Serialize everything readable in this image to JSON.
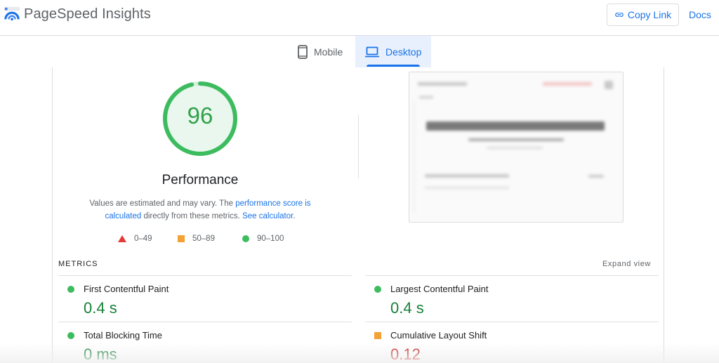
{
  "header": {
    "app_title": "PageSpeed Insights",
    "copy_link_label": "Copy Link",
    "docs_label": "Docs",
    "logo_icon": "pagespeed-logo-icon"
  },
  "tabs": [
    {
      "label": "Mobile",
      "icon": "phone-icon",
      "selected": false
    },
    {
      "label": "Desktop",
      "icon": "laptop-icon",
      "selected": true
    }
  ],
  "performance": {
    "score": "96",
    "score_fraction": 0.96,
    "title": "Performance",
    "desc_prefix": "Values are estimated and may vary. The ",
    "desc_link1": "performance score is calculated",
    "desc_mid": " directly from these metrics. ",
    "desc_link2": "See calculator",
    "desc_suffix": ".",
    "legend": [
      {
        "range": "0–49",
        "shape": "triangle",
        "color": "#e53935"
      },
      {
        "range": "50–89",
        "shape": "square",
        "color": "#f4a234"
      },
      {
        "range": "90–100",
        "shape": "circle",
        "color": "#3dbc5f"
      }
    ]
  },
  "metrics_section": {
    "label": "METRICS",
    "expand_label": "Expand view",
    "items": [
      {
        "name": "First Contentful Paint",
        "value": "0.4 s",
        "status": "good"
      },
      {
        "name": "Largest Contentful Paint",
        "value": "0.4 s",
        "status": "good"
      },
      {
        "name": "Total Blocking Time",
        "value": "0 ms",
        "status": "good"
      },
      {
        "name": "Cumulative Layout Shift",
        "value": "0.12",
        "status": "average"
      }
    ]
  },
  "colors": {
    "accent": "#1a73e8",
    "good": "#3dbc5f",
    "average": "#f4a234",
    "poor": "#e53935"
  }
}
